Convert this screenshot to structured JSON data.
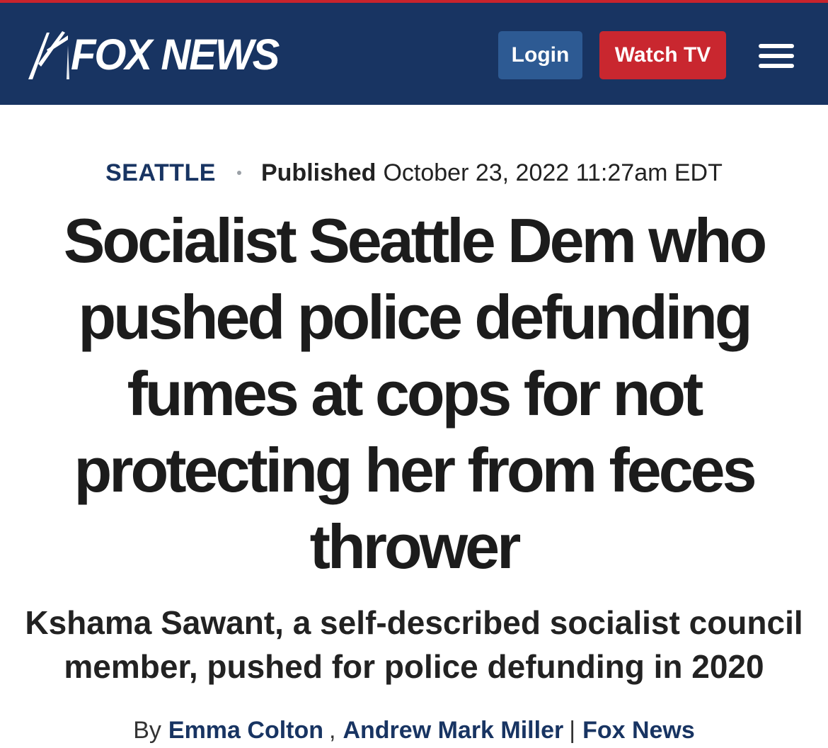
{
  "header": {
    "logo_text": "FOX NEWS",
    "login_label": "Login",
    "watch_label": "Watch TV",
    "brand_color": "#183462",
    "accent_color": "#c9272f",
    "menu_icon": "hamburger-menu-icon"
  },
  "article": {
    "section": "SEATTLE",
    "published_label": "Published",
    "published_date": "October 23, 2022 11:27am EDT",
    "headline": "Socialist Seattle Dem who pushed police defunding fumes at cops for not protecting her from feces thrower",
    "subheadline": "Kshama Sawant, a self-described socialist council member, pushed for police defunding in 2020",
    "byline": {
      "by": "By",
      "authors": [
        "Emma Colton",
        "Andrew Mark Miller"
      ],
      "author_separator": ",",
      "source_separator": "|",
      "source": "Fox News"
    }
  }
}
